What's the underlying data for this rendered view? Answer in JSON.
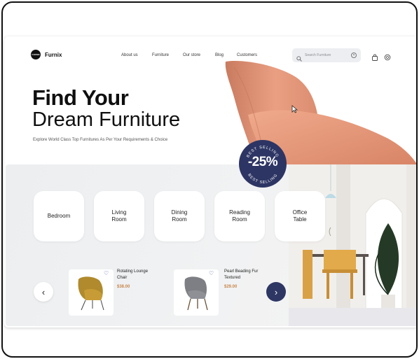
{
  "brand": {
    "name": "Furnix",
    "mark_text": "FURNIX"
  },
  "nav": {
    "links": [
      "About us",
      "Furniture",
      "Our store",
      "Blog",
      "Customers"
    ]
  },
  "search": {
    "placeholder": "Search Furniture"
  },
  "icons": [
    "search-icon",
    "close-icon",
    "shopping-bag-icon",
    "support-icon",
    "heart-icon",
    "chevron-left-icon",
    "chevron-right-icon",
    "cursor-icon"
  ],
  "hero": {
    "title_line1": "Find Your",
    "title_line2": "Dream Furniture",
    "subtitle": "Explore World Class Top Furnitures As Per Your Requirements & Choice"
  },
  "badge": {
    "discount": "-25%",
    "ring_top": "BEST SELLING",
    "ring_bottom": "BEST SELLING"
  },
  "categories": [
    {
      "label": "Bedroom"
    },
    {
      "label": "Living\nRoom"
    },
    {
      "label": "Dining\nRoom"
    },
    {
      "label": "Reading\nRoom"
    },
    {
      "label": "Office\nTable"
    }
  ],
  "products": [
    {
      "name": "Rotating Lounge\nChair",
      "price": "$38.00"
    },
    {
      "name": "Pearl Beading Fur\nTextured",
      "price": "$29.00"
    }
  ],
  "colors": {
    "accent_navy": "#2e3664",
    "chair_peach": "#e69a7e",
    "price_orange": "#c8874e"
  }
}
